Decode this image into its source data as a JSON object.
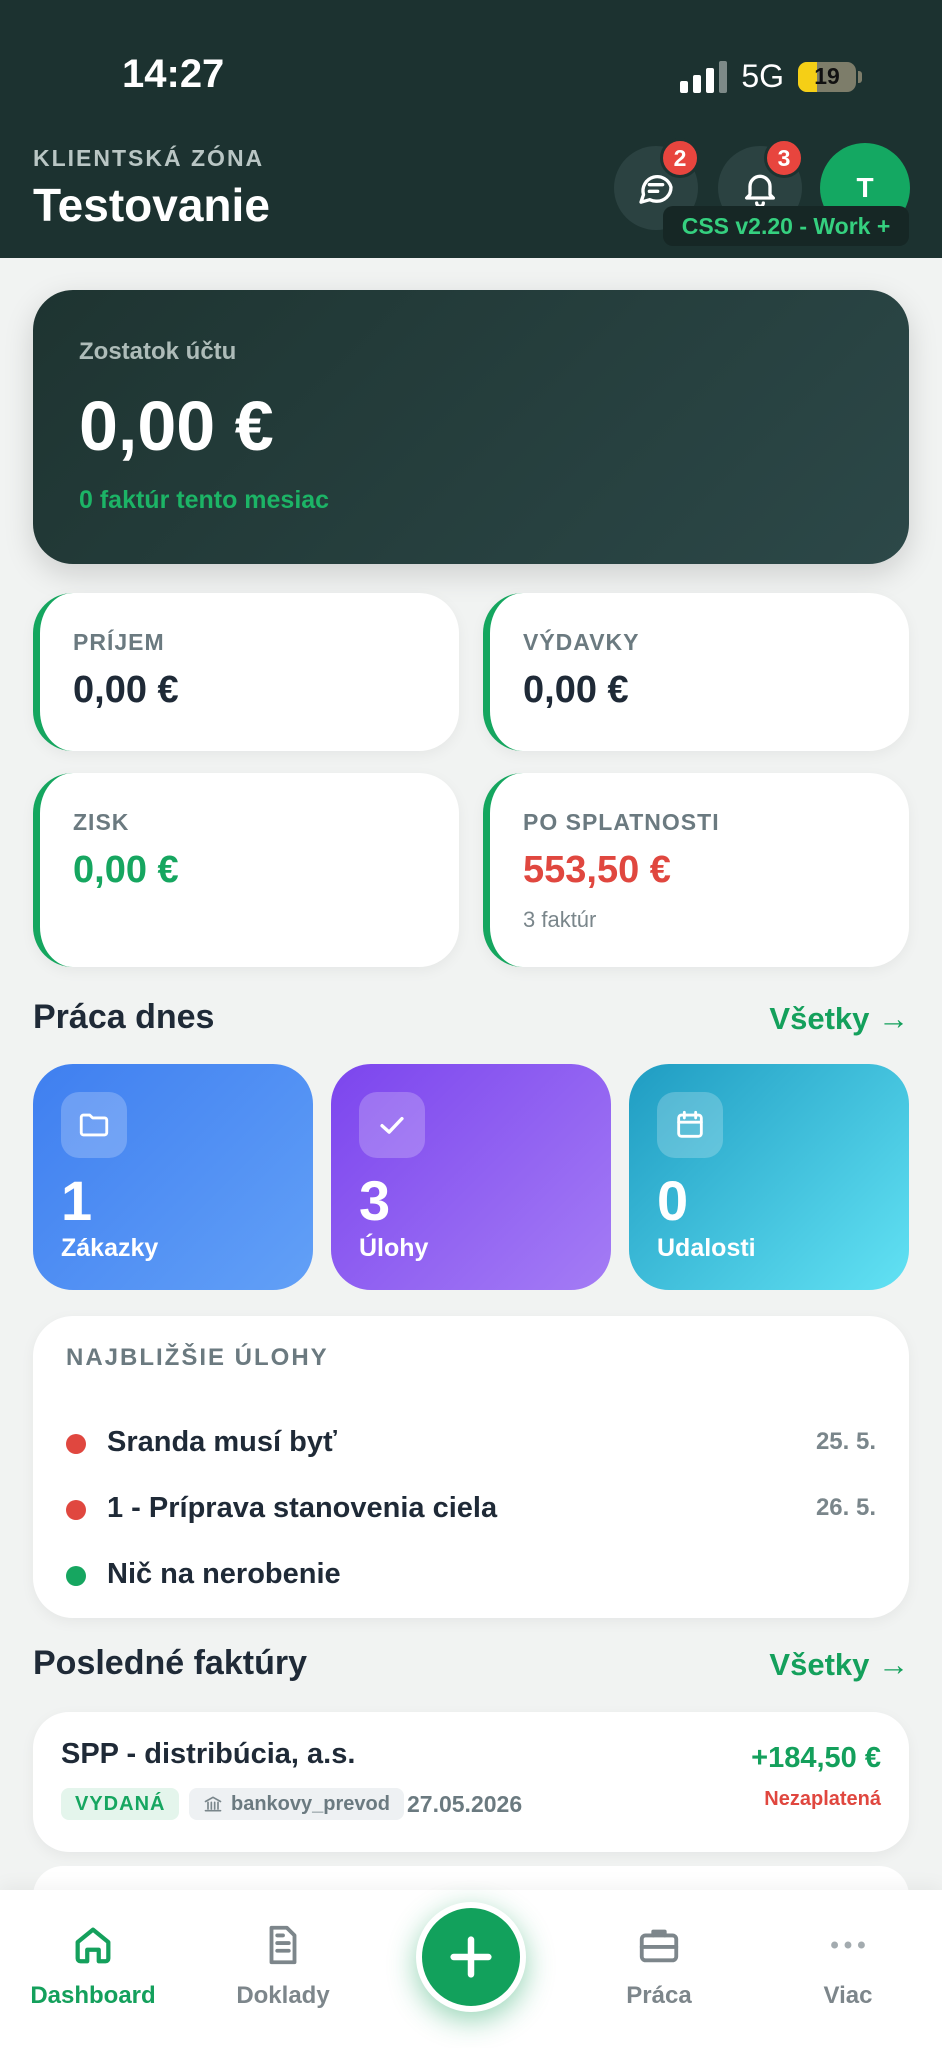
{
  "status_bar": {
    "time": "14:27",
    "network": "5G",
    "battery": "19"
  },
  "header": {
    "subtitle": "KLIENTSKÁ ZÓNA",
    "title": "Testovanie",
    "messages_badge": "2",
    "notifications_badge": "3",
    "avatar_initial": "T",
    "version_tag": "CSS v2.20 - Work +"
  },
  "balance": {
    "label": "Zostatok účtu",
    "value": "0,00 €",
    "note": "0 faktúr tento mesiac"
  },
  "stats": {
    "income": {
      "label": "PRÍJEM",
      "value": "0,00 €"
    },
    "expenses": {
      "label": "VÝDAVKY",
      "value": "0,00 €"
    },
    "profit": {
      "label": "ZISK",
      "value": "0,00 €"
    },
    "overdue": {
      "label": "PO SPLATNOSTI",
      "value": "553,50 €",
      "sub": "3 faktúr"
    }
  },
  "work_today": {
    "title": "Práca dnes",
    "link": "Všetky →",
    "tiles": [
      {
        "count": "1",
        "label": "Zákazky",
        "icon": "folder-icon"
      },
      {
        "count": "3",
        "label": "Úlohy",
        "icon": "check-icon"
      },
      {
        "count": "0",
        "label": "Udalosti",
        "icon": "calendar-icon"
      }
    ]
  },
  "upcoming_tasks": {
    "title": "NAJBLIŽŠIE ÚLOHY",
    "items": [
      {
        "name": "Sranda musí byť",
        "date": "25. 5.",
        "color": "#e0473f"
      },
      {
        "name": "1 - Príprava stanovenia ciela",
        "date": "26. 5.",
        "color": "#e0473f"
      },
      {
        "name": "Nič na nerobenie",
        "date": "",
        "color": "#16a660"
      }
    ]
  },
  "recent_invoices": {
    "title": "Posledné faktúry",
    "link": "Všetky →",
    "items": [
      {
        "name": "SPP - distribúcia, a.s.",
        "amount": "+184,50 €",
        "state": "Nezaplatená",
        "status": "VYDANÁ",
        "method": "bankovy_prevod",
        "date": "27.05.2026"
      }
    ]
  },
  "bottom_nav": {
    "items": [
      {
        "label": "Dashboard",
        "icon": "home-icon",
        "active": true
      },
      {
        "label": "Doklady",
        "icon": "document-icon",
        "active": false
      },
      {
        "label": "Práca",
        "icon": "briefcase-icon",
        "active": false
      },
      {
        "label": "Viac",
        "icon": "more-icon",
        "active": false
      }
    ],
    "fab_icon": "plus-icon"
  },
  "colors": {
    "header_bg": "#1c3230",
    "accent_green": "#14a05c",
    "alert_red": "#e0473f",
    "tile_blue": "#4a86f0",
    "tile_purple": "#8a55f0",
    "tile_teal": "#26a8cc"
  }
}
